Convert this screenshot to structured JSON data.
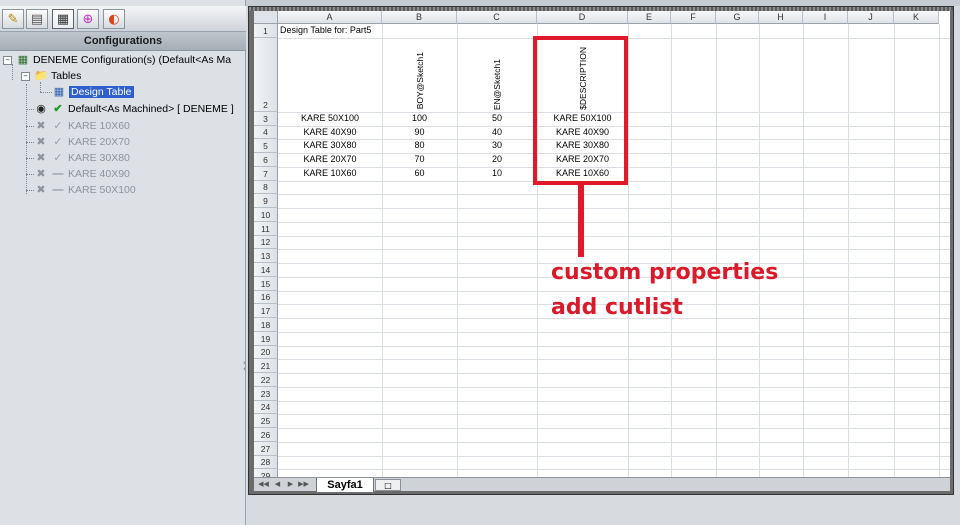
{
  "left_panel": {
    "toolbar_icons": [
      "feature-manager-icon",
      "property-manager-icon",
      "configuration-manager-icon",
      "dimxpert-icon",
      "display-manager-icon"
    ],
    "header": "Configurations",
    "tree": {
      "root": "DENEME Configuration(s)  (Default<As Ma",
      "tables": "Tables",
      "design_table": "Design Table",
      "default_config": "Default<As Machined> [ DENEME ]",
      "configs": [
        "KARE 10X60",
        "KARE 20X70",
        "KARE 30X80",
        "KARE 40X90",
        "KARE 50X100"
      ]
    }
  },
  "sheet": {
    "columns": [
      "A",
      "B",
      "C",
      "D",
      "E",
      "F",
      "G",
      "H",
      "I",
      "J",
      "K"
    ],
    "row_numbers": [
      "1",
      "2",
      "3",
      "4",
      "5",
      "6",
      "7",
      "8",
      "9",
      "10",
      "11",
      "12",
      "13",
      "14",
      "15",
      "16",
      "17",
      "18",
      "19",
      "20",
      "21",
      "22",
      "23",
      "24",
      "25",
      "26",
      "27",
      "28",
      "29"
    ],
    "title_cell": "Design Table for: Part5",
    "headers": [
      "BOY@Sketch1",
      "EN@Sketch1",
      "$DESCRIPTION"
    ],
    "rows": [
      [
        "KARE 50X100",
        "100",
        "50",
        "KARE 50X100"
      ],
      [
        "KARE 40X90",
        "90",
        "40",
        "KARE 40X90"
      ],
      [
        "KARE 30X80",
        "80",
        "30",
        "KARE 30X80"
      ],
      [
        "KARE 20X70",
        "70",
        "20",
        "KARE 20X70"
      ],
      [
        "KARE 10X60",
        "60",
        "10",
        "KARE 10X60"
      ]
    ],
    "tab_name": "Sayfa1"
  },
  "annotation": {
    "line1": "custom properties",
    "line2": "add cutlist",
    "color": "#e0192b"
  }
}
